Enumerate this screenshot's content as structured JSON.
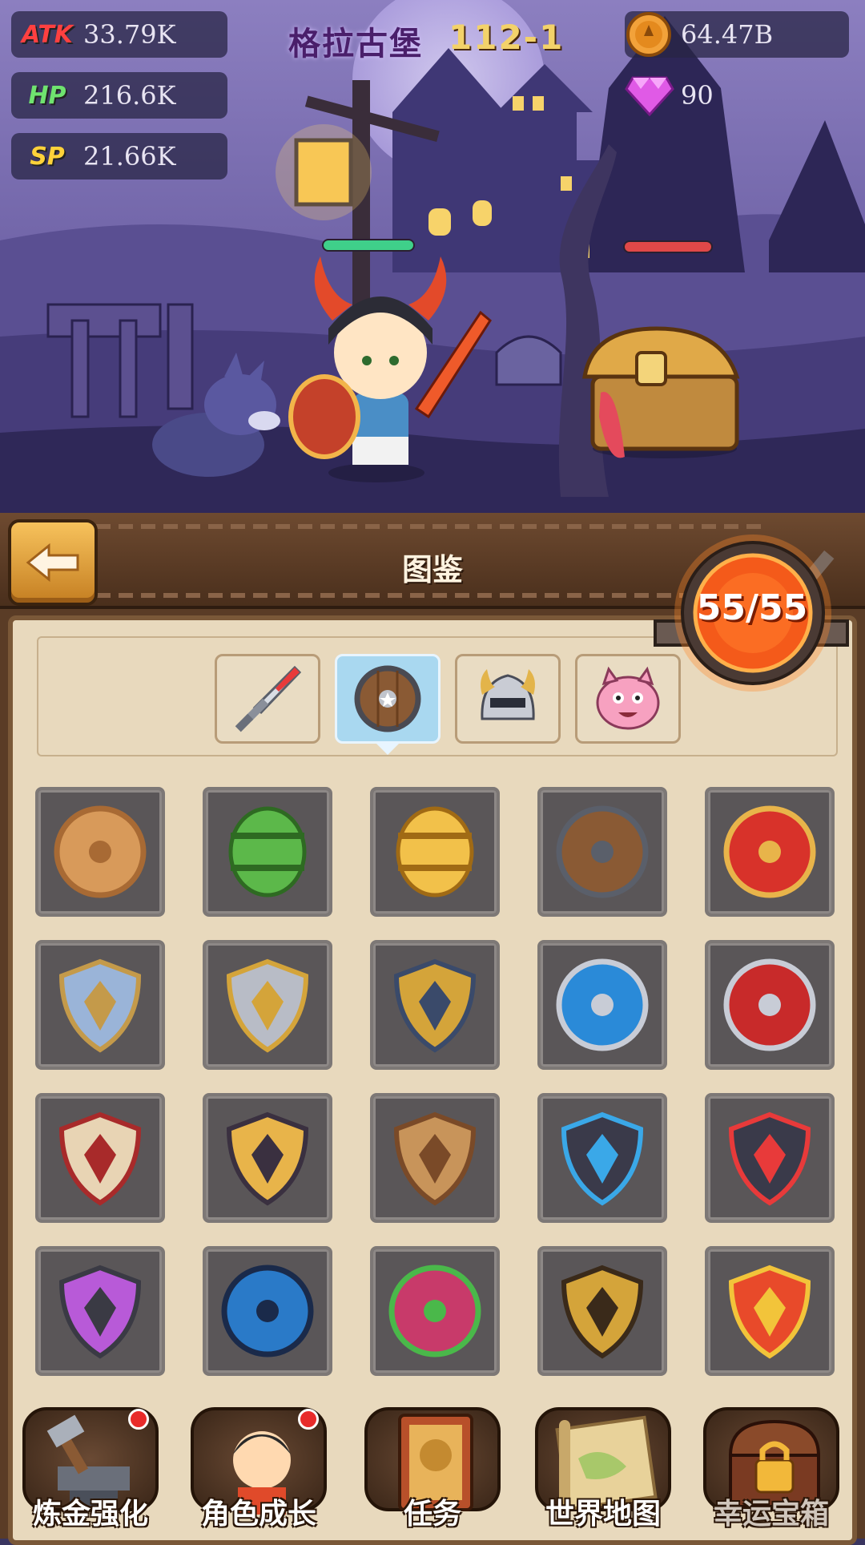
{
  "hud": {
    "stats": [
      {
        "label": "ATK",
        "value": "33.79K",
        "color": "#ff4040"
      },
      {
        "label": "HP",
        "value": "216.6K",
        "color": "#6fe36f"
      },
      {
        "label": "SP",
        "value": "21.66K",
        "color": "#ffd23a"
      }
    ],
    "stage_name": "格拉古堡",
    "stage_number": "112-1",
    "gold": {
      "icon": "gold-coin-icon",
      "value": "64.47B"
    },
    "gems": {
      "icon": "gem-icon",
      "value": "90"
    }
  },
  "battle": {
    "hero_hp_fraction": 1.0,
    "enemy_hp_fraction": 1.0,
    "hero": "horned-helmet-knight",
    "pet": "wolf",
    "enemy": "mimic-chest"
  },
  "panel": {
    "title": "图鉴",
    "back_icon": "back-arrow-icon",
    "counter": "55/55",
    "tabs": [
      {
        "icon": "sword-icon",
        "active": false
      },
      {
        "icon": "shield-icon",
        "active": true
      },
      {
        "icon": "helmet-icon",
        "active": false
      },
      {
        "icon": "pet-icon",
        "active": false
      }
    ],
    "shields": [
      "wood-log-shield",
      "green-barrel-shield",
      "yellow-barrel-shield",
      "wooden-star-shield",
      "red-star-shield",
      "cross-kite-shield",
      "silver-spiked-shield",
      "gold-spiked-shield",
      "blue-cross-round-shield",
      "red-cross-round-shield",
      "bone-ribcage-shield",
      "pharaoh-mask-shield",
      "stone-tablet-shield",
      "blue-gem-dark-shield",
      "red-gem-dark-shield",
      "purple-mask-shield",
      "blue-spiral-shield",
      "flower-shield",
      "horned-gold-shield",
      "flame-phoenix-shield"
    ]
  },
  "nav": [
    {
      "label": "炼金强化",
      "icon": "anvil-hammer-icon",
      "badge": true,
      "locked": false
    },
    {
      "label": "角色成长",
      "icon": "character-icon",
      "badge": true,
      "locked": false
    },
    {
      "label": "任务",
      "icon": "quest-book-icon",
      "badge": false,
      "locked": false
    },
    {
      "label": "世界地图",
      "icon": "world-map-icon",
      "badge": false,
      "locked": false
    },
    {
      "label": "幸运宝箱",
      "icon": "treasure-chest-lock-icon",
      "badge": false,
      "locked": true
    }
  ]
}
